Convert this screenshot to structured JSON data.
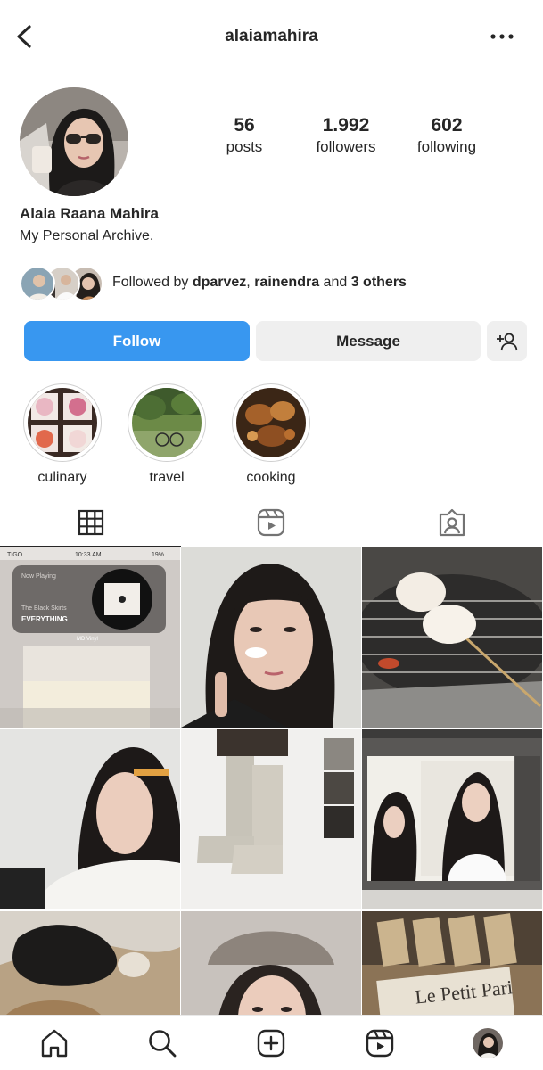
{
  "header": {
    "username": "alaiamahira"
  },
  "stats": [
    {
      "value": "56",
      "label": "posts"
    },
    {
      "value": "1.992",
      "label": "followers"
    },
    {
      "value": "602",
      "label": "following"
    }
  ],
  "profile": {
    "full_name": "Alaia Raana Mahira",
    "bio": "My Personal Archive."
  },
  "followed_by": {
    "prefix": "Followed by ",
    "user1": "dparvez",
    "sep": ", ",
    "user2": "rainendra",
    "conj": " and ",
    "others": "3 others"
  },
  "buttons": {
    "follow": "Follow",
    "message": "Message"
  },
  "highlights": [
    {
      "label": "culinary"
    },
    {
      "label": "travel"
    },
    {
      "label": "cooking"
    }
  ],
  "tabs": [
    "grid-icon",
    "reels-icon",
    "tagged-icon"
  ],
  "post_overlay": {
    "carrier": "TIGO",
    "time": "10:33 AM",
    "battery": "19%",
    "now_playing": "Now Playing",
    "artist": "The Black Skirts",
    "song": "EVERYTHING",
    "device": "MD Vinyl"
  },
  "newspaper_text": "Le Petit Pari",
  "nav": [
    "home-icon",
    "search-icon",
    "create-icon",
    "reels-icon",
    "profile-avatar"
  ],
  "colors": {
    "follow_button": "#3897f0",
    "secondary_button": "#efefef",
    "text": "#262626"
  }
}
